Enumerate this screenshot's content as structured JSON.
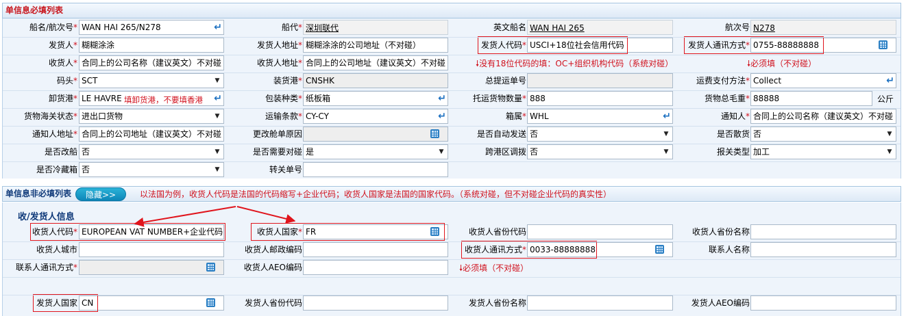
{
  "required_section": {
    "title": "单信息必填列表",
    "rows": [
      [
        {
          "label": "船名/航次号",
          "req": true,
          "value": "WAN HAI 265/N278",
          "kind": "enter"
        },
        {
          "label": "船代",
          "req": true,
          "value": "深圳联代",
          "kind": "link"
        },
        {
          "label": "英文船名",
          "req": false,
          "value": "WAN HAI 265",
          "kind": "link"
        },
        {
          "label": "航次号",
          "req": false,
          "value": "N278",
          "kind": "linkbox"
        }
      ],
      [
        {
          "label": "发货人",
          "req": true,
          "value": "糊糊涂涂",
          "kind": "text"
        },
        {
          "label": "发货人地址",
          "req": true,
          "value": "糊糊涂涂的公司地址（不对碰）",
          "kind": "text"
        },
        {
          "label": "发货人代码",
          "req": true,
          "value": "USCI+18位社会信用代码",
          "kind": "text"
        },
        {
          "label": "发货人通讯方式",
          "req": true,
          "value": "0755-88888888",
          "kind": "grid"
        }
      ],
      [
        {
          "label": "收货人",
          "req": true,
          "value": "合同上的公司名称（建议英文）不对碰",
          "kind": "text"
        },
        {
          "label": "收货人地址",
          "req": true,
          "value": "合同上的公司地址（建议英文）不对碰",
          "kind": "text"
        },
        null,
        null
      ],
      [
        {
          "label": "码头",
          "req": true,
          "value": "SCT",
          "kind": "select"
        },
        {
          "label": "装货港",
          "req": true,
          "value": "CNSHK",
          "kind": "ro"
        },
        {
          "label": "总提运单号",
          "req": false,
          "value": "",
          "kind": "ro"
        },
        {
          "label": "运费支付方法",
          "req": true,
          "value": "Collect",
          "kind": "enter"
        }
      ],
      [
        {
          "label": "卸货港",
          "req": true,
          "value": "LE HAVRE",
          "kind": "enter"
        },
        {
          "label": "包装种类",
          "req": true,
          "value": "纸板箱",
          "kind": "enter"
        },
        {
          "label": "托运货物数量",
          "req": true,
          "value": "888",
          "kind": "text"
        },
        {
          "label": "货物总毛重",
          "req": true,
          "value": "88888",
          "kind": "unit"
        }
      ],
      [
        {
          "label": "货物海关状态",
          "req": true,
          "value": "进出口货物",
          "kind": "select"
        },
        {
          "label": "运输条款",
          "req": true,
          "value": "CY-CY",
          "kind": "enter"
        },
        {
          "label": "箱属",
          "req": true,
          "value": "WHL",
          "kind": "enter"
        },
        {
          "label": "通知人",
          "req": true,
          "value": "合同上的公司名称（建议英文）不对碰",
          "kind": "text"
        }
      ],
      [
        {
          "label": "通知人地址",
          "req": true,
          "value": "合同上的公司地址（建议英文）不对碰",
          "kind": "text"
        },
        {
          "label": "更改舱单原因",
          "req": false,
          "value": "",
          "kind": "gridro"
        },
        {
          "label": "是否自动发送",
          "req": false,
          "value": "否",
          "kind": "select"
        },
        {
          "label": "是否散货",
          "req": false,
          "value": "否",
          "kind": "select"
        }
      ],
      [
        {
          "label": "是否改船",
          "req": false,
          "value": "否",
          "kind": "select"
        },
        {
          "label": "是否需要对碰",
          "req": false,
          "value": "是",
          "kind": "select"
        },
        {
          "label": "跨港区调拨",
          "req": false,
          "value": "否",
          "kind": "select"
        },
        {
          "label": "报关类型",
          "req": false,
          "value": "加工",
          "kind": "select"
        }
      ],
      [
        {
          "label": "是否冷藏箱",
          "req": false,
          "value": "否",
          "kind": "select"
        },
        {
          "label": "转关单号",
          "req": false,
          "value": "",
          "kind": "text"
        },
        null,
        null
      ]
    ],
    "gross_weight_unit": "公斤",
    "discharge_port_note": "填卸货港，不要填香港",
    "note_no18": "没有18位代码的填：OC+组织机构代码（系统对碰）",
    "note_required_1": "必须填（不对碰）"
  },
  "optional_section": {
    "title": "单信息非必填列表",
    "hide_button": "隐藏>>",
    "hint": "以法国为例，收货人代码是法国的代码缩写+企业代码；收货人国家是法国的国家代码。（系统对碰，但不对碰企业代码的真实性）",
    "subheading": "收/发货人信息",
    "consignee_rows": [
      [
        {
          "label": "收货人代码",
          "req": true,
          "value": "EUROPEAN VAT NUMBER+企业代码",
          "kind": "text"
        },
        {
          "label": "收货人国家",
          "req": true,
          "value": "FR",
          "kind": "grid"
        },
        {
          "label": "收货人省份代码",
          "req": false,
          "value": "",
          "kind": "text"
        },
        {
          "label": "收货人省份名称",
          "req": false,
          "value": "",
          "kind": "text"
        }
      ],
      [
        {
          "label": "收货人城市",
          "req": false,
          "value": "",
          "kind": "text"
        },
        {
          "label": "收货人邮政编码",
          "req": false,
          "value": "",
          "kind": "text"
        },
        {
          "label": "收货人通讯方式",
          "req": true,
          "value": "0033-88888888",
          "kind": "grid"
        },
        {
          "label": "联系人名称",
          "req": false,
          "value": "",
          "kind": "text"
        }
      ],
      [
        {
          "label": "联系人通讯方式",
          "req": true,
          "value": "",
          "kind": "gridro"
        },
        {
          "label": "收货人AEO编码",
          "req": false,
          "value": "",
          "kind": "text"
        },
        null,
        null
      ]
    ],
    "note_required_2": "必须填（不对碰）",
    "shipper_row": [
      {
        "label": "发货人国家",
        "req": false,
        "value": "CN",
        "kind": "grid"
      },
      {
        "label": "发货人省份代码",
        "req": false,
        "value": "",
        "kind": "text"
      },
      {
        "label": "发货人省份名称",
        "req": false,
        "value": "",
        "kind": "text"
      },
      {
        "label": "发货人AEO编码",
        "req": false,
        "value": "",
        "kind": "text"
      }
    ]
  },
  "colors": {
    "annotation": "#e0141c",
    "required_star": "#d0101c",
    "header_blue": "#103a7a"
  }
}
